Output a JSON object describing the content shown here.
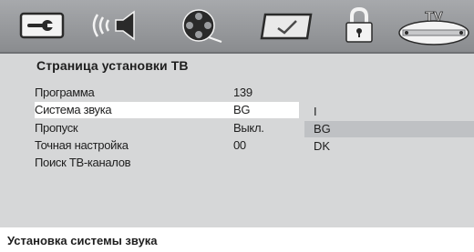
{
  "icons": [
    {
      "name": "settings-wrench-icon"
    },
    {
      "name": "audio-speaker-icon"
    },
    {
      "name": "video-film-reel-icon"
    },
    {
      "name": "preferences-check-icon"
    },
    {
      "name": "lock-icon"
    },
    {
      "name": "tv-icon",
      "label": "TV"
    }
  ],
  "page": {
    "title": "Страница установки ТВ"
  },
  "menu": {
    "items": [
      {
        "label": "Программа",
        "value": "139"
      },
      {
        "label": "Система звука",
        "value": "BG"
      },
      {
        "label": "Пропуск",
        "value": "Выкл."
      },
      {
        "label": "Точная настройка",
        "value": "00"
      },
      {
        "label": "Поиск ТВ-каналов",
        "value": ""
      }
    ],
    "selected_index": 1
  },
  "options": {
    "items": [
      "I",
      "BG",
      "DK"
    ],
    "highlighted_index": 1
  },
  "status": {
    "text": "Установка системы звука"
  },
  "colors": {
    "background": "#d6d7d8",
    "icon_bar": "#9a9c9f",
    "highlight": "#bfc1c4",
    "selected_row": "#ffffff"
  }
}
